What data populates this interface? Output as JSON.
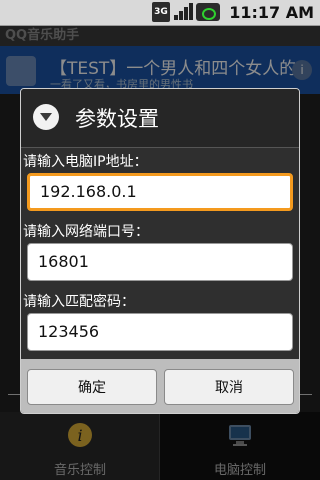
{
  "status_bar": {
    "network": "3G",
    "time": "11:17 AM"
  },
  "app": {
    "title": "QQ音乐助手"
  },
  "notification": {
    "text": "【TEST】一个男人和四个女人的",
    "subtext": "一看了又看，书房里的男性书"
  },
  "dialog": {
    "title": "参数设置",
    "fields": [
      {
        "label": "请输入电脑IP地址：",
        "value": "192.168.0.1"
      },
      {
        "label": "请输入网络端口号：",
        "value": "16801"
      },
      {
        "label": "请输入匹配密码：",
        "value": "123456"
      }
    ],
    "ok_label": "确定",
    "cancel_label": "取消"
  },
  "tabs": [
    {
      "label": "音乐控制",
      "icon": "info-icon"
    },
    {
      "label": "电脑控制",
      "icon": "computer-icon"
    }
  ],
  "colors": {
    "focus": "#f49a1e",
    "notification_bg": "#1c55a8"
  }
}
